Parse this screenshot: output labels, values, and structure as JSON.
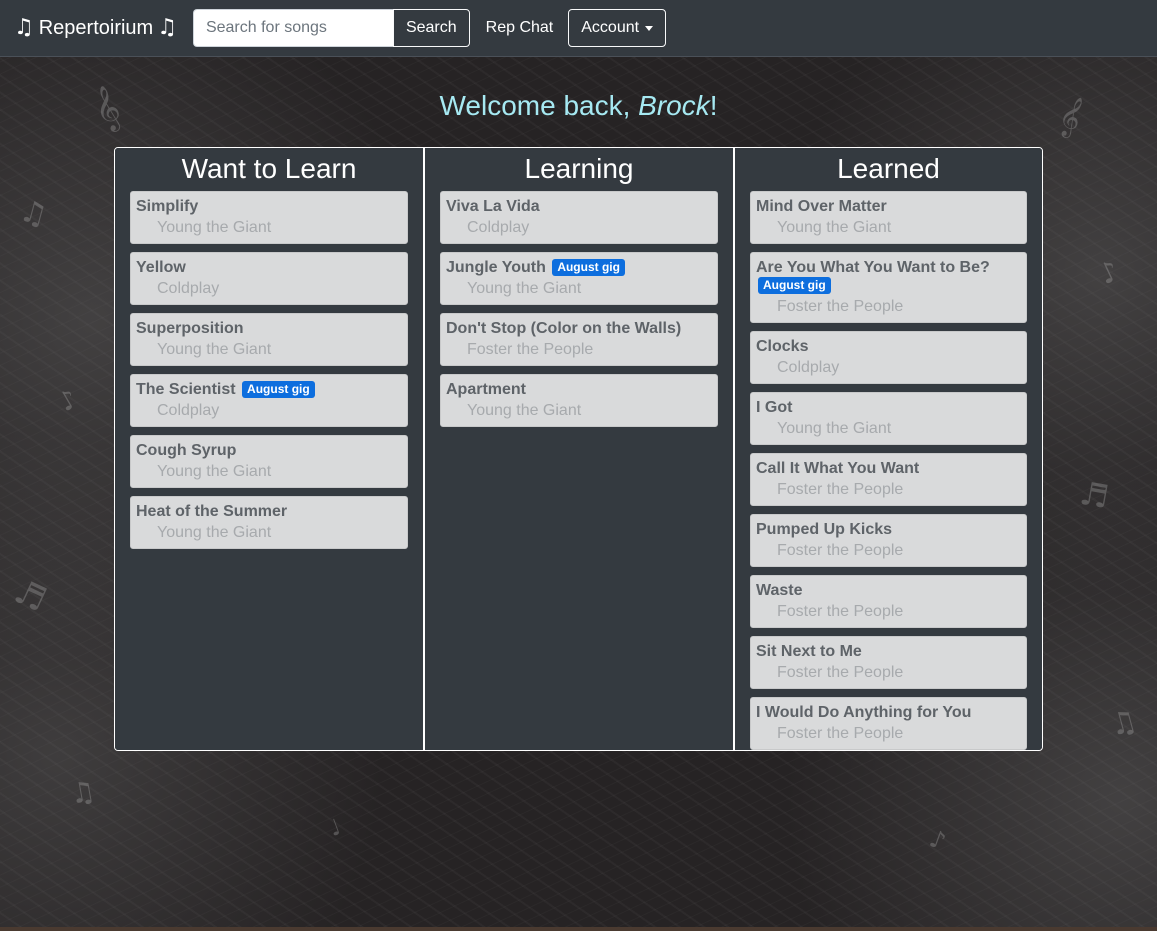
{
  "navbar": {
    "brand": "Repertoirium",
    "brand_icon": "music-note-icon",
    "search_placeholder": "Search for songs",
    "search_button": "Search",
    "rep_chat": "Rep Chat",
    "account": "Account"
  },
  "welcome": {
    "prefix": "Welcome back, ",
    "name": "Brock",
    "suffix": "!"
  },
  "colors": {
    "navbar_bg": "#343a40",
    "welcome_text": "#a6e9f2",
    "badge_bg": "#0d6ede",
    "card_bg": "#d9dadb"
  },
  "columns": [
    {
      "title": "Want to Learn",
      "songs": [
        {
          "title": "Simplify",
          "artist": "Young the Giant",
          "badge": ""
        },
        {
          "title": "Yellow",
          "artist": "Coldplay",
          "badge": ""
        },
        {
          "title": "Superposition",
          "artist": "Young the Giant",
          "badge": ""
        },
        {
          "title": "The Scientist",
          "artist": "Coldplay",
          "badge": "August gig"
        },
        {
          "title": "Cough Syrup",
          "artist": "Young the Giant",
          "badge": ""
        },
        {
          "title": "Heat of the Summer",
          "artist": "Young the Giant",
          "badge": ""
        }
      ]
    },
    {
      "title": "Learning",
      "songs": [
        {
          "title": "Viva La Vida",
          "artist": "Coldplay",
          "badge": ""
        },
        {
          "title": "Jungle Youth",
          "artist": "Young the Giant",
          "badge": "August gig"
        },
        {
          "title": "Don't Stop (Color on the Walls)",
          "artist": "Foster the People",
          "badge": ""
        },
        {
          "title": "Apartment",
          "artist": "Young the Giant",
          "badge": ""
        }
      ]
    },
    {
      "title": "Learned",
      "songs": [
        {
          "title": "Mind Over Matter",
          "artist": "Young the Giant",
          "badge": ""
        },
        {
          "title": "Are You What You Want to Be?",
          "artist": "Foster the People",
          "badge": "August gig"
        },
        {
          "title": "Clocks",
          "artist": "Coldplay",
          "badge": ""
        },
        {
          "title": "I Got",
          "artist": "Young the Giant",
          "badge": ""
        },
        {
          "title": "Call It What You Want",
          "artist": "Foster the People",
          "badge": ""
        },
        {
          "title": "Pumped Up Kicks",
          "artist": "Foster the People",
          "badge": ""
        },
        {
          "title": "Waste",
          "artist": "Foster the People",
          "badge": ""
        },
        {
          "title": "Sit Next to Me",
          "artist": "Foster the People",
          "badge": ""
        },
        {
          "title": "I Would Do Anything for You",
          "artist": "Foster the People",
          "badge": ""
        }
      ]
    }
  ]
}
